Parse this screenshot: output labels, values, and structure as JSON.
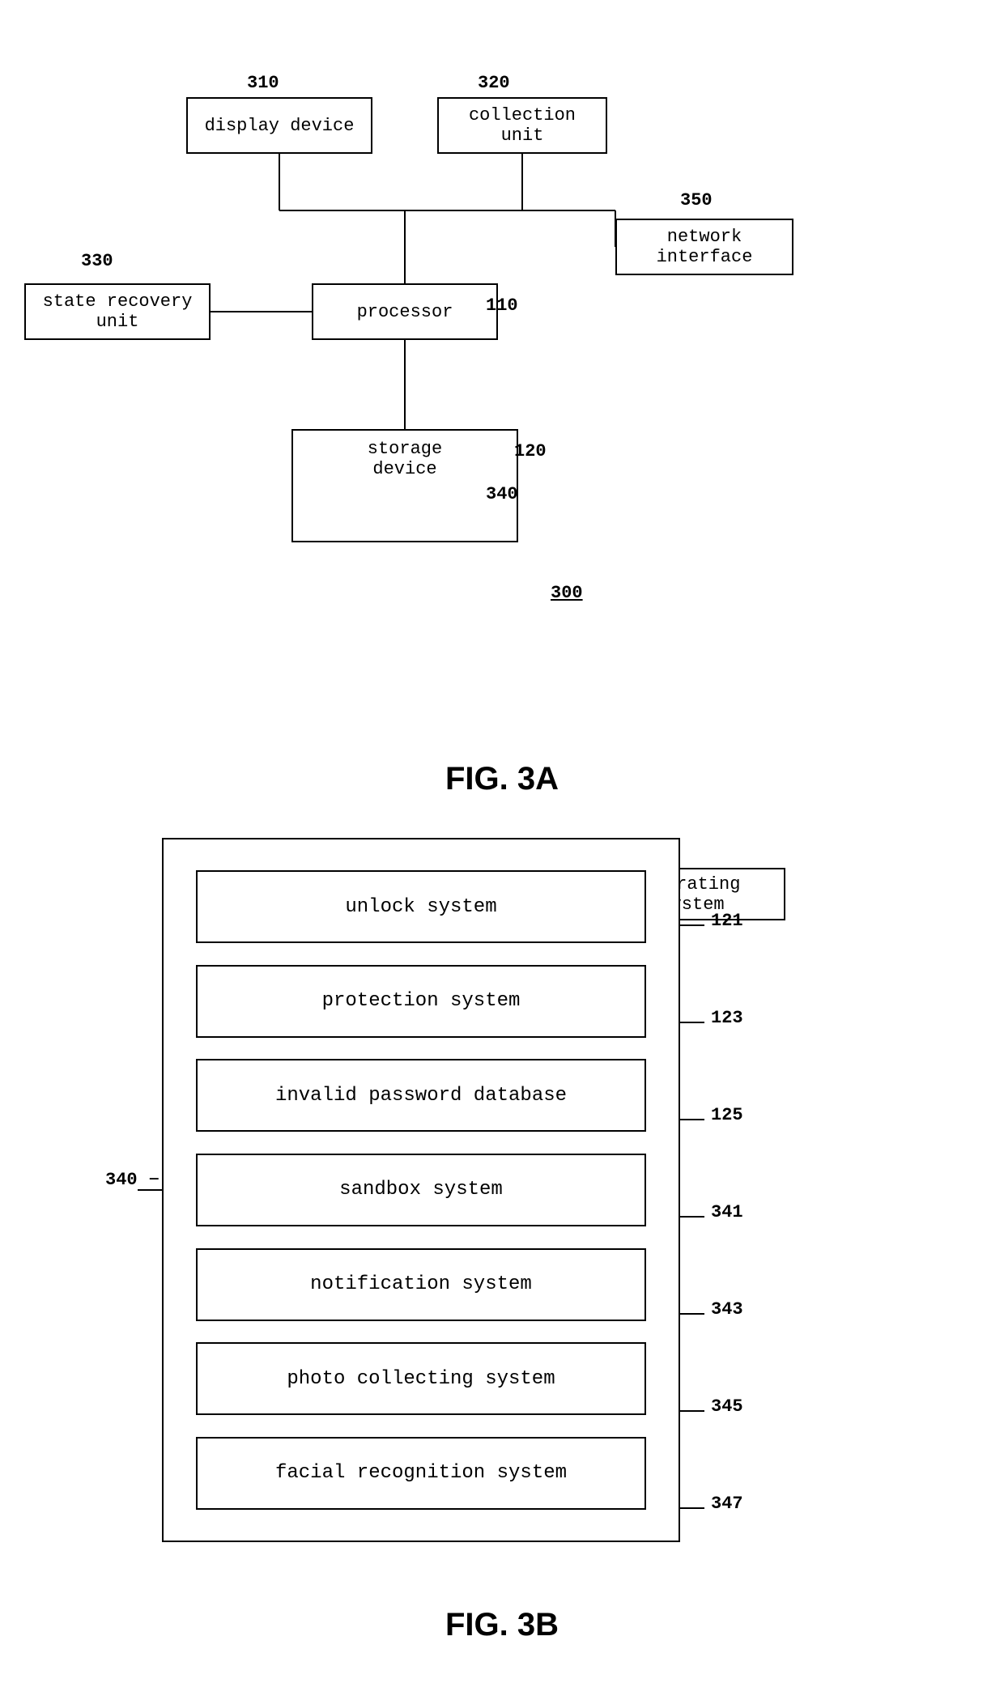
{
  "fig3a": {
    "title": "FIG. 3A",
    "ref_number": "300",
    "boxes": {
      "display_device": "display device",
      "collection_unit": "collection unit",
      "processor": "processor",
      "state_recovery_unit": "state recovery unit",
      "network_interface": "network interface",
      "storage_device": "storage device",
      "operating_system": "operating system"
    },
    "labels": {
      "n310": "310",
      "n320": "320",
      "n330": "330",
      "n350": "350",
      "n110": "110",
      "n120": "120",
      "n340": "340"
    }
  },
  "fig3b": {
    "title": "FIG. 3B",
    "ref_340": "340",
    "items": [
      {
        "label": "unlock system",
        "ref": "121"
      },
      {
        "label": "protection system",
        "ref": "123"
      },
      {
        "label": "invalid password database",
        "ref": "125"
      },
      {
        "label": "sandbox system",
        "ref": "341"
      },
      {
        "label": "notification system",
        "ref": "343"
      },
      {
        "label": "photo collecting system",
        "ref": "345"
      },
      {
        "label": "facial recognition system",
        "ref": "347"
      }
    ]
  }
}
